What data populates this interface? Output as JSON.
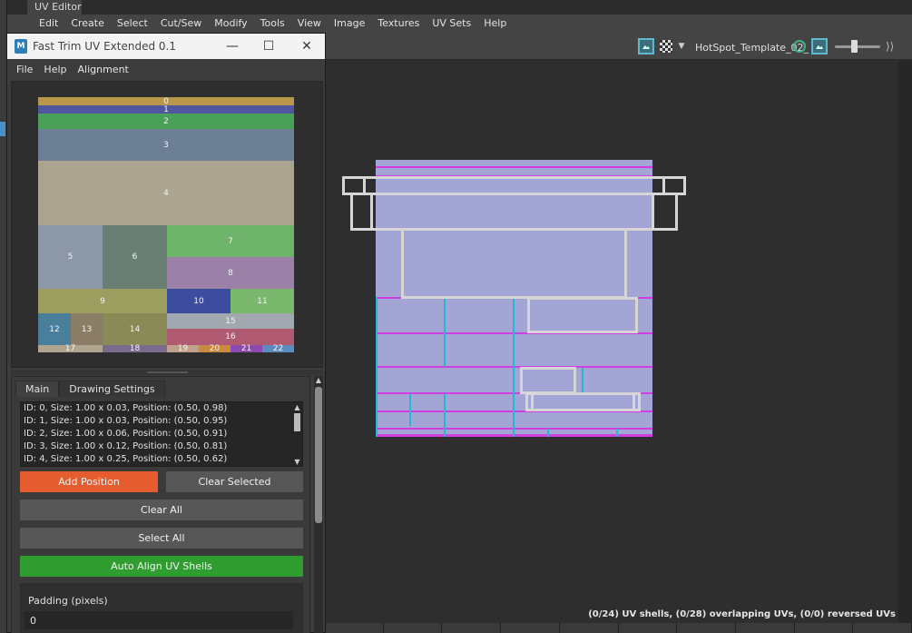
{
  "app": {
    "editor_title": "UV Editor",
    "menu": [
      "Edit",
      "Create",
      "Select",
      "Cut/Sew",
      "Modify",
      "Tools",
      "View",
      "Image",
      "Textures",
      "UV Sets",
      "Help"
    ],
    "texture_name": "HotSpot_Template_02_",
    "status": "(0/24) UV shells, (0/28) overlapping UVs, (0/0) reversed UVs"
  },
  "plugin": {
    "title": "Fast Trim UV Extended 0.1",
    "logo_letter": "M",
    "window_controls": {
      "minimize": "—",
      "maximize": "☐",
      "close": "✕"
    },
    "menu": [
      "File",
      "Help",
      "Alignment"
    ],
    "tabs": [
      "Main",
      "Drawing Settings"
    ],
    "active_tab": "Main",
    "list_items": [
      "ID: 0, Size: 1.00 x 0.03, Position: (0.50, 0.98)",
      "ID: 1, Size: 1.00 x 0.03, Position: (0.50, 0.95)",
      "ID: 2, Size: 1.00 x 0.06, Position: (0.50, 0.91)",
      "ID: 3, Size: 1.00 x 0.12, Position: (0.50, 0.81)",
      "ID: 4, Size: 1.00 x 0.25, Position: (0.50, 0.62)"
    ],
    "buttons": {
      "add_position": "Add Position",
      "clear_selected": "Clear Selected",
      "clear_all": "Clear All",
      "select_all": "Select All",
      "auto_align": "Auto Align UV Shells"
    },
    "padding_label": "Padding (pixels)",
    "padding_value": "0",
    "colors": {
      "add_button": "#e55c2e",
      "auto_align_button": "#2f9d30"
    }
  },
  "trims": [
    {
      "id": "0",
      "color": "#b8964a"
    },
    {
      "id": "1",
      "color": "#5055a0"
    },
    {
      "id": "2",
      "color": "#4aa056"
    },
    {
      "id": "3",
      "color": "#6c7f94"
    },
    {
      "id": "4",
      "color": "#aba58f"
    },
    {
      "id": "5",
      "color": "#8c98a8"
    },
    {
      "id": "6",
      "color": "#6a7f74"
    },
    {
      "id": "7",
      "color": "#6eb36a"
    },
    {
      "id": "8",
      "color": "#9b80a8"
    },
    {
      "id": "9",
      "color": "#9c9e60"
    },
    {
      "id": "10",
      "color": "#3e4ca0"
    },
    {
      "id": "11",
      "color": "#7ab86e"
    },
    {
      "id": "12",
      "color": "#4a7f9c"
    },
    {
      "id": "13",
      "color": "#8c7d66"
    },
    {
      "id": "14",
      "color": "#898a55"
    },
    {
      "id": "15",
      "color": "#a2a8b0"
    },
    {
      "id": "16",
      "color": "#b05a72"
    },
    {
      "id": "17",
      "color": "#b0a690"
    },
    {
      "id": "18",
      "color": "#7a6a8c"
    },
    {
      "id": "19",
      "color": "#c0a088"
    },
    {
      "id": "20",
      "color": "#c88a3e"
    },
    {
      "id": "21",
      "color": "#8c4ab0"
    },
    {
      "id": "22",
      "color": "#5a8cc0"
    }
  ]
}
